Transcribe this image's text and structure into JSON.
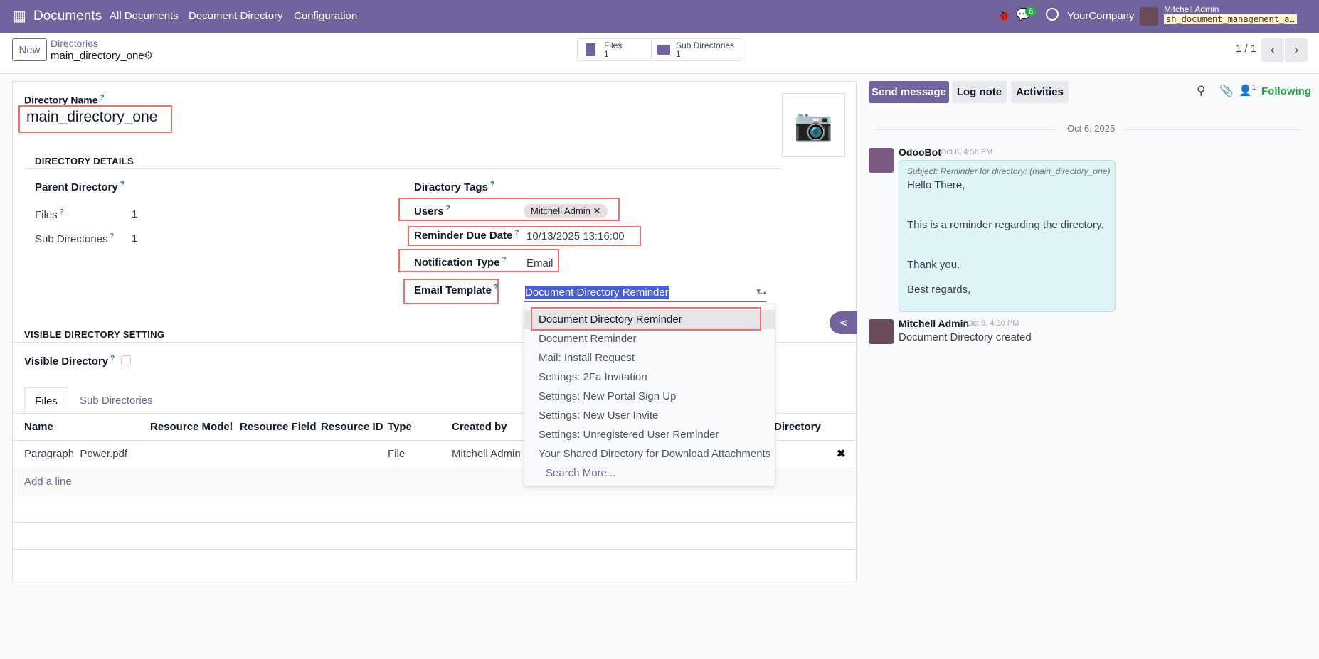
{
  "navbar": {
    "app": "Documents",
    "menu": [
      "All Documents",
      "Document Directory",
      "Configuration"
    ],
    "message_count": "8",
    "company": "YourCompany",
    "user": "Mitchell Admin",
    "database": "sh_document_management_a…"
  },
  "control": {
    "new": "New",
    "breadcrumb_parent": "Directories",
    "breadcrumb_current": "main_directory_one",
    "stats": [
      {
        "label": "Files",
        "value": "1"
      },
      {
        "label": "Sub Directories",
        "value": "1"
      }
    ],
    "pager": "1 / 1"
  },
  "form": {
    "name_label": "Directory Name",
    "name_value": "main_directory_one",
    "section_details": "DIRECTORY DETAILS",
    "parent_label": "Parent Directory",
    "files_label": "Files",
    "files_value": "1",
    "subdirs_label": "Sub Directories",
    "subdirs_value": "1",
    "tags_label": "Diractory Tags",
    "users_label": "Users",
    "user_tag": "Mitchell Admin",
    "reminder_label": "Reminder Due Date",
    "reminder_value": "10/13/2025 13:16:00",
    "notif_label": "Notification Type",
    "notif_value": "Email",
    "template_label": "Email Template",
    "template_value": "Document Directory Reminder",
    "section_visible": "VISIBLE DIRECTORY SETTING",
    "visible_label": "Visible Directory",
    "visible_checked": false
  },
  "dropdown": {
    "items": [
      "Document Directory Reminder",
      "Document Reminder",
      "Mail: Install Request",
      "Settings: 2Fa Invitation",
      "Settings: New Portal Sign Up",
      "Settings: New User Invite",
      "Settings: Unregistered User Reminder",
      "Your Shared Directory for Download Attachments"
    ],
    "search_more": "Search More..."
  },
  "tabs": [
    "Files",
    "Sub Directories"
  ],
  "table": {
    "columns": [
      "Name",
      "Resource Model",
      "Resource Field",
      "Resource ID",
      "Type",
      "Created by",
      "Directory"
    ],
    "rows": [
      {
        "name": "Paragraph_Power.pdf",
        "type": "File",
        "created_by": "Mitchell Admin"
      }
    ],
    "add_line": "Add a line"
  },
  "chatter": {
    "send": "Send message",
    "log": "Log note",
    "activities": "Activities",
    "followers": "1",
    "following": "Following",
    "date": "Oct 6, 2025",
    "messages": [
      {
        "author": "OdooBot",
        "time": "Oct 6, 4:58 PM",
        "subject": "Subject: Reminder for directory: (main_directory_one)",
        "lines": [
          "Hello There,",
          "This is a reminder regarding the directory.",
          "Thank you.",
          "Best regards,"
        ]
      },
      {
        "author": "Mitchell Admin",
        "time": "Oct 6, 4:30 PM",
        "body": "Document Directory created"
      }
    ]
  },
  "colors": {
    "brand": "#71639e",
    "highlight": "#f26d6d",
    "following": "#28a745"
  }
}
